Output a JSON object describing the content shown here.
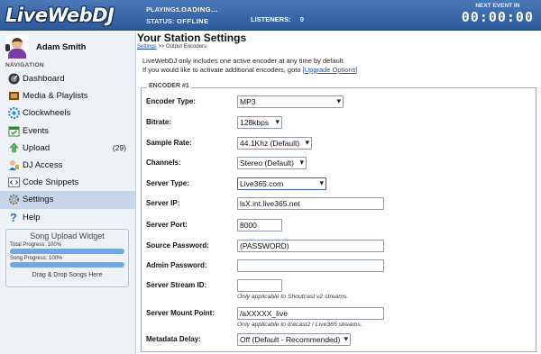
{
  "header": {
    "logo": "LiveWebDJ",
    "playing_label": "PLAYING:",
    "playing_value": "LOADING...",
    "status_label": "STATUS:",
    "status_value": "OFFLINE",
    "listeners_label": "LISTENERS:",
    "listeners_value": "0",
    "next_event_label": "NEXT EVENT IN",
    "next_event_timer": "00:00:00"
  },
  "sidebar": {
    "user_name": "Adam Smith",
    "nav_heading": "NAVIGATION",
    "items": [
      {
        "label": "Dashboard",
        "icon": "dashboard-icon"
      },
      {
        "label": "Media & Playlists",
        "icon": "media-icon"
      },
      {
        "label": "Clockwheels",
        "icon": "clockwheel-icon"
      },
      {
        "label": "Events",
        "icon": "events-icon"
      },
      {
        "label": "Upload",
        "icon": "upload-icon",
        "count": "(29)"
      },
      {
        "label": "DJ Access",
        "icon": "dj-access-icon"
      },
      {
        "label": "Code Snippets",
        "icon": "code-icon"
      },
      {
        "label": "Settings",
        "icon": "gear-icon",
        "active": true
      },
      {
        "label": "Help",
        "icon": "help-icon"
      }
    ],
    "widget": {
      "title": "Song Upload Widget",
      "total_progress": "Total Progress: 100%",
      "song_progress": "Song Progress: 100%",
      "total_progress_fraction": 1.0,
      "song_progress_fraction": 1.0,
      "dropzone": "Drag & Drop Songs Here"
    }
  },
  "main": {
    "title": "Your Station Settings",
    "breadcrumb_link": "Settings",
    "breadcrumb_rest": " >> Output Encoders",
    "intro_line1": "LiveWebDJ only includes one active encoder at any time by default.",
    "intro_line2": "If you would like to activate additional encoders, goto ",
    "upgrade_link": "[Upgrade Options]",
    "encoder_legend": "ENCODER #1",
    "fields": {
      "encoder_type": {
        "label": "Encoder Type:",
        "value": "MP3"
      },
      "bitrate": {
        "label": "Bitrate:",
        "value": "128kbps"
      },
      "sample_rate": {
        "label": "Sample Rate:",
        "value": "44.1Khz (Default)"
      },
      "channels": {
        "label": "Channels:",
        "value": "Stereo (Default)"
      },
      "server_type": {
        "label": "Server Type:",
        "value": "Live365.com"
      },
      "server_ip": {
        "label": "Server IP:",
        "value": "lsX.int.live365.net"
      },
      "server_port": {
        "label": "Server Port:",
        "value": "8000"
      },
      "source_password": {
        "label": "Source Password:",
        "value": "(PASSWORD)"
      },
      "admin_password": {
        "label": "Admin Password:",
        "value": ""
      },
      "stream_id": {
        "label": "Server Stream ID:",
        "value": "",
        "hint": "Only applicable to Shoutcast v2 streams."
      },
      "mount_point": {
        "label": "Server Mount Point:",
        "value": "/aXXXXX_live",
        "hint": "Only applicable to Icecast2 / Live365 streams."
      },
      "metadata_delay": {
        "label": "Metadata Delay:",
        "value": "Off (Default - Recommended)"
      }
    }
  }
}
